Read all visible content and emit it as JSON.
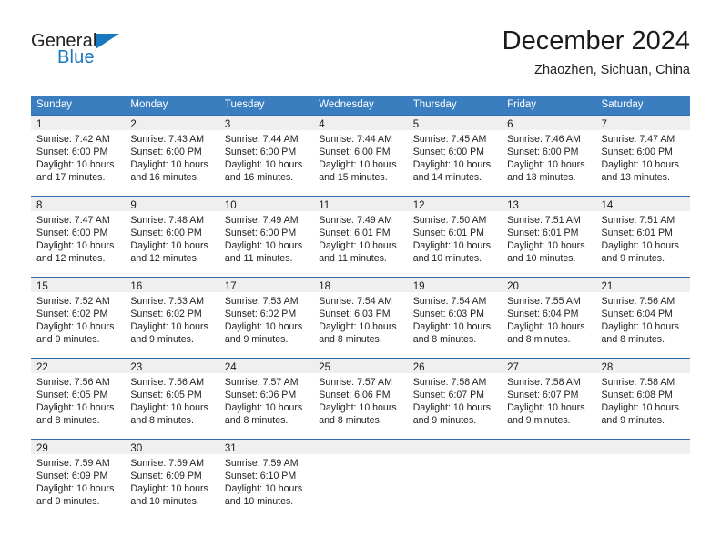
{
  "logo": {
    "primary_text": "General",
    "secondary_text": "Blue",
    "triangle_color": "#1878be",
    "primary_color": "#231f20"
  },
  "header": {
    "title": "December 2024",
    "subtitle": "Zhaozhen, Sichuan, China"
  },
  "theme": {
    "header_blue": "#3a7ebf",
    "rule_blue": "#2f6fae",
    "day_band_gray": "#efefef"
  },
  "weekday_headers": [
    "Sunday",
    "Monday",
    "Tuesday",
    "Wednesday",
    "Thursday",
    "Friday",
    "Saturday"
  ],
  "weeks": [
    [
      {
        "day": "1",
        "sunrise": "Sunrise: 7:42 AM",
        "sunset": "Sunset: 6:00 PM",
        "daylight_1": "Daylight: 10 hours",
        "daylight_2": "and 17 minutes."
      },
      {
        "day": "2",
        "sunrise": "Sunrise: 7:43 AM",
        "sunset": "Sunset: 6:00 PM",
        "daylight_1": "Daylight: 10 hours",
        "daylight_2": "and 16 minutes."
      },
      {
        "day": "3",
        "sunrise": "Sunrise: 7:44 AM",
        "sunset": "Sunset: 6:00 PM",
        "daylight_1": "Daylight: 10 hours",
        "daylight_2": "and 16 minutes."
      },
      {
        "day": "4",
        "sunrise": "Sunrise: 7:44 AM",
        "sunset": "Sunset: 6:00 PM",
        "daylight_1": "Daylight: 10 hours",
        "daylight_2": "and 15 minutes."
      },
      {
        "day": "5",
        "sunrise": "Sunrise: 7:45 AM",
        "sunset": "Sunset: 6:00 PM",
        "daylight_1": "Daylight: 10 hours",
        "daylight_2": "and 14 minutes."
      },
      {
        "day": "6",
        "sunrise": "Sunrise: 7:46 AM",
        "sunset": "Sunset: 6:00 PM",
        "daylight_1": "Daylight: 10 hours",
        "daylight_2": "and 13 minutes."
      },
      {
        "day": "7",
        "sunrise": "Sunrise: 7:47 AM",
        "sunset": "Sunset: 6:00 PM",
        "daylight_1": "Daylight: 10 hours",
        "daylight_2": "and 13 minutes."
      }
    ],
    [
      {
        "day": "8",
        "sunrise": "Sunrise: 7:47 AM",
        "sunset": "Sunset: 6:00 PM",
        "daylight_1": "Daylight: 10 hours",
        "daylight_2": "and 12 minutes."
      },
      {
        "day": "9",
        "sunrise": "Sunrise: 7:48 AM",
        "sunset": "Sunset: 6:00 PM",
        "daylight_1": "Daylight: 10 hours",
        "daylight_2": "and 12 minutes."
      },
      {
        "day": "10",
        "sunrise": "Sunrise: 7:49 AM",
        "sunset": "Sunset: 6:00 PM",
        "daylight_1": "Daylight: 10 hours",
        "daylight_2": "and 11 minutes."
      },
      {
        "day": "11",
        "sunrise": "Sunrise: 7:49 AM",
        "sunset": "Sunset: 6:01 PM",
        "daylight_1": "Daylight: 10 hours",
        "daylight_2": "and 11 minutes."
      },
      {
        "day": "12",
        "sunrise": "Sunrise: 7:50 AM",
        "sunset": "Sunset: 6:01 PM",
        "daylight_1": "Daylight: 10 hours",
        "daylight_2": "and 10 minutes."
      },
      {
        "day": "13",
        "sunrise": "Sunrise: 7:51 AM",
        "sunset": "Sunset: 6:01 PM",
        "daylight_1": "Daylight: 10 hours",
        "daylight_2": "and 10 minutes."
      },
      {
        "day": "14",
        "sunrise": "Sunrise: 7:51 AM",
        "sunset": "Sunset: 6:01 PM",
        "daylight_1": "Daylight: 10 hours",
        "daylight_2": "and 9 minutes."
      }
    ],
    [
      {
        "day": "15",
        "sunrise": "Sunrise: 7:52 AM",
        "sunset": "Sunset: 6:02 PM",
        "daylight_1": "Daylight: 10 hours",
        "daylight_2": "and 9 minutes."
      },
      {
        "day": "16",
        "sunrise": "Sunrise: 7:53 AM",
        "sunset": "Sunset: 6:02 PM",
        "daylight_1": "Daylight: 10 hours",
        "daylight_2": "and 9 minutes."
      },
      {
        "day": "17",
        "sunrise": "Sunrise: 7:53 AM",
        "sunset": "Sunset: 6:02 PM",
        "daylight_1": "Daylight: 10 hours",
        "daylight_2": "and 9 minutes."
      },
      {
        "day": "18",
        "sunrise": "Sunrise: 7:54 AM",
        "sunset": "Sunset: 6:03 PM",
        "daylight_1": "Daylight: 10 hours",
        "daylight_2": "and 8 minutes."
      },
      {
        "day": "19",
        "sunrise": "Sunrise: 7:54 AM",
        "sunset": "Sunset: 6:03 PM",
        "daylight_1": "Daylight: 10 hours",
        "daylight_2": "and 8 minutes."
      },
      {
        "day": "20",
        "sunrise": "Sunrise: 7:55 AM",
        "sunset": "Sunset: 6:04 PM",
        "daylight_1": "Daylight: 10 hours",
        "daylight_2": "and 8 minutes."
      },
      {
        "day": "21",
        "sunrise": "Sunrise: 7:56 AM",
        "sunset": "Sunset: 6:04 PM",
        "daylight_1": "Daylight: 10 hours",
        "daylight_2": "and 8 minutes."
      }
    ],
    [
      {
        "day": "22",
        "sunrise": "Sunrise: 7:56 AM",
        "sunset": "Sunset: 6:05 PM",
        "daylight_1": "Daylight: 10 hours",
        "daylight_2": "and 8 minutes."
      },
      {
        "day": "23",
        "sunrise": "Sunrise: 7:56 AM",
        "sunset": "Sunset: 6:05 PM",
        "daylight_1": "Daylight: 10 hours",
        "daylight_2": "and 8 minutes."
      },
      {
        "day": "24",
        "sunrise": "Sunrise: 7:57 AM",
        "sunset": "Sunset: 6:06 PM",
        "daylight_1": "Daylight: 10 hours",
        "daylight_2": "and 8 minutes."
      },
      {
        "day": "25",
        "sunrise": "Sunrise: 7:57 AM",
        "sunset": "Sunset: 6:06 PM",
        "daylight_1": "Daylight: 10 hours",
        "daylight_2": "and 8 minutes."
      },
      {
        "day": "26",
        "sunrise": "Sunrise: 7:58 AM",
        "sunset": "Sunset: 6:07 PM",
        "daylight_1": "Daylight: 10 hours",
        "daylight_2": "and 9 minutes."
      },
      {
        "day": "27",
        "sunrise": "Sunrise: 7:58 AM",
        "sunset": "Sunset: 6:07 PM",
        "daylight_1": "Daylight: 10 hours",
        "daylight_2": "and 9 minutes."
      },
      {
        "day": "28",
        "sunrise": "Sunrise: 7:58 AM",
        "sunset": "Sunset: 6:08 PM",
        "daylight_1": "Daylight: 10 hours",
        "daylight_2": "and 9 minutes."
      }
    ],
    [
      {
        "day": "29",
        "sunrise": "Sunrise: 7:59 AM",
        "sunset": "Sunset: 6:09 PM",
        "daylight_1": "Daylight: 10 hours",
        "daylight_2": "and 9 minutes."
      },
      {
        "day": "30",
        "sunrise": "Sunrise: 7:59 AM",
        "sunset": "Sunset: 6:09 PM",
        "daylight_1": "Daylight: 10 hours",
        "daylight_2": "and 10 minutes."
      },
      {
        "day": "31",
        "sunrise": "Sunrise: 7:59 AM",
        "sunset": "Sunset: 6:10 PM",
        "daylight_1": "Daylight: 10 hours",
        "daylight_2": "and 10 minutes."
      },
      {
        "day": "",
        "sunrise": "",
        "sunset": "",
        "daylight_1": "",
        "daylight_2": ""
      },
      {
        "day": "",
        "sunrise": "",
        "sunset": "",
        "daylight_1": "",
        "daylight_2": ""
      },
      {
        "day": "",
        "sunrise": "",
        "sunset": "",
        "daylight_1": "",
        "daylight_2": ""
      },
      {
        "day": "",
        "sunrise": "",
        "sunset": "",
        "daylight_1": "",
        "daylight_2": ""
      }
    ]
  ]
}
